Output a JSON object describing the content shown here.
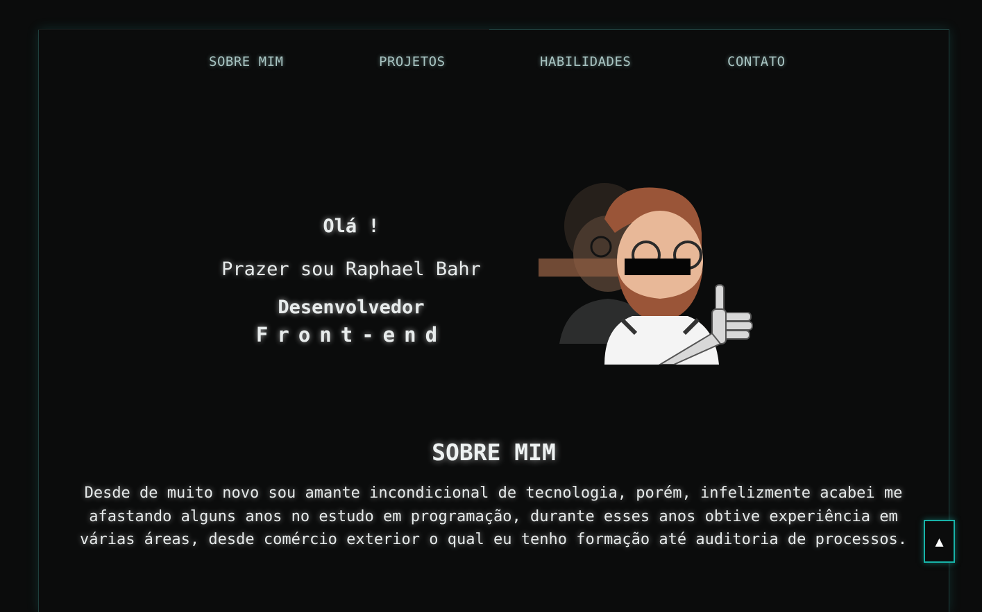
{
  "nav": {
    "items": [
      {
        "label": "SOBRE MIM"
      },
      {
        "label": "PROJETOS"
      },
      {
        "label": "HABILIDADES"
      },
      {
        "label": "CONTATO"
      }
    ]
  },
  "hero": {
    "greeting": "Olá !",
    "intro": "Prazer sou Raphael Bahr",
    "role_line1": "Desenvolvedor",
    "role_line2": "Front-end"
  },
  "about": {
    "title": "SOBRE MIM",
    "text": "Desde de muito novo sou amante incondicional de tecnologia, porém, infelizmente acabei me afastando alguns anos no estudo em programação, durante esses anos obtive experiência em várias áreas, desde comércio exterior o qual eu tenho formação até auditoria de processos."
  },
  "back_to_top": {
    "label": "▲"
  },
  "colors": {
    "background": "#0b0c0c",
    "accent": "#17b3a8",
    "nav_text": "#a8c4c2",
    "text": "#e8ecec"
  }
}
